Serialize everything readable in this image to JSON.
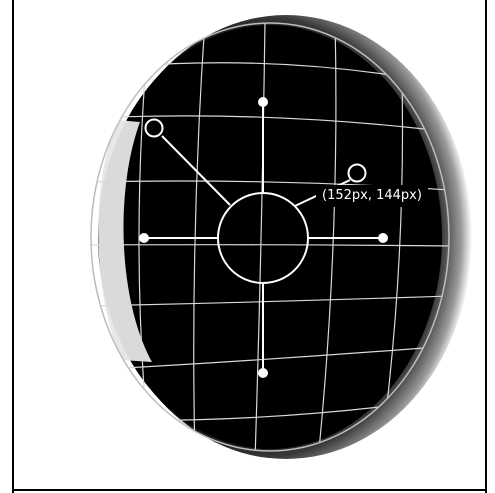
{
  "editor": {
    "coordinate_readout": "(152px, 144px)"
  },
  "colors": {
    "background": "#ffffff",
    "lens_fill": "#000000",
    "grid_line": "#d9d9d9",
    "handle": "#ffffff"
  },
  "icons": {
    "center_handle": "circle-outline-icon",
    "radius_handle": "dot-icon",
    "rotate_handle": "ring-icon"
  }
}
